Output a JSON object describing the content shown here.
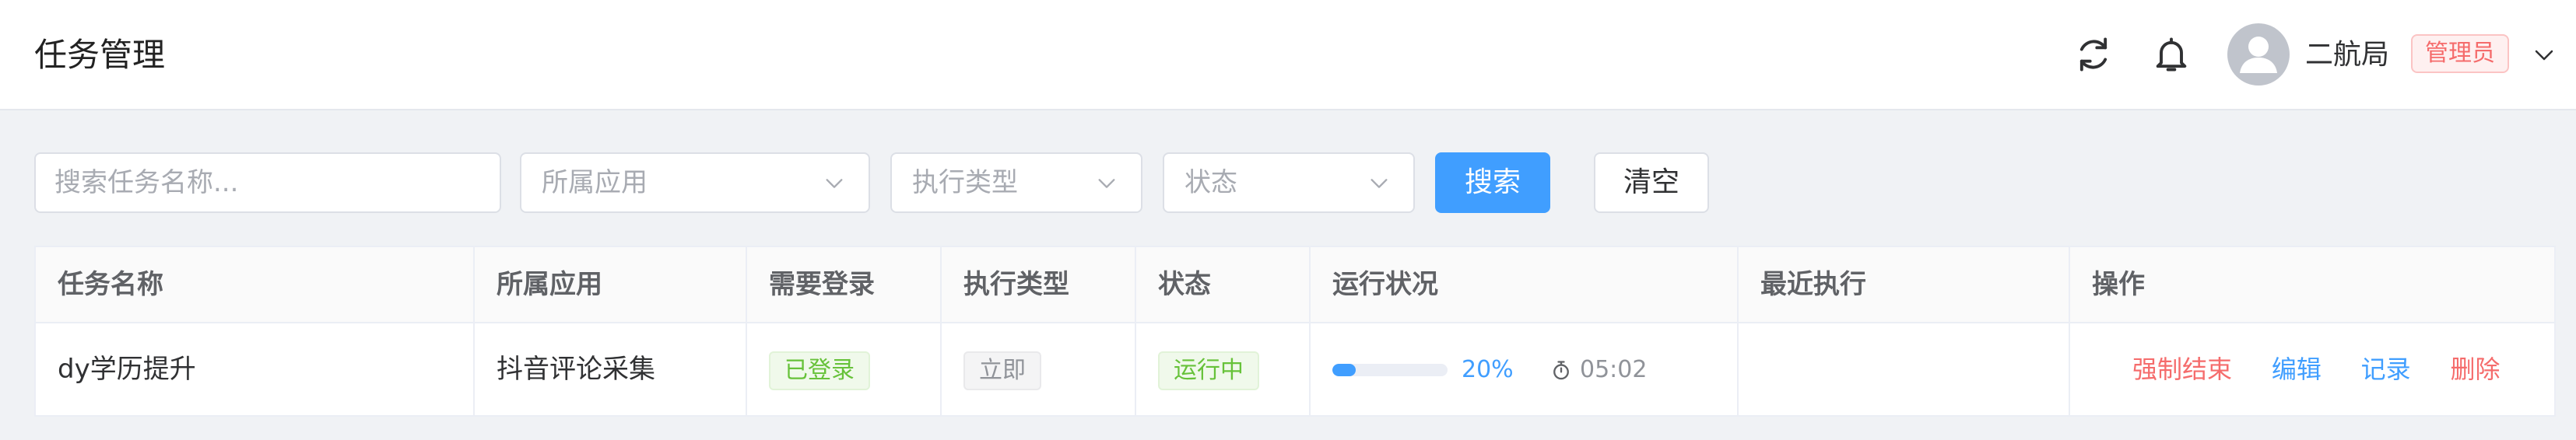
{
  "header": {
    "title": "任务管理",
    "user_name": "二航局",
    "role": "管理员"
  },
  "filters": {
    "search_placeholder": "搜索任务名称...",
    "app_placeholder": "所属应用",
    "exec_type_placeholder": "执行类型",
    "status_placeholder": "状态",
    "search_button": "搜索",
    "clear_button": "清空"
  },
  "table": {
    "columns": [
      "任务名称",
      "所属应用",
      "需要登录",
      "执行类型",
      "状态",
      "运行状况",
      "最近执行",
      "操作"
    ],
    "rows": [
      {
        "task_name": "dy学历提升",
        "app": "抖音评论采集",
        "login": "已登录",
        "exec_type": "立即",
        "status": "运行中",
        "progress": 0.2,
        "progress_text": "20%",
        "elapsed": "05:02",
        "last_run": "",
        "actions": [
          "强制结束",
          "编辑",
          "记录",
          "删除"
        ]
      }
    ]
  },
  "colors": {
    "primary": "#409eff",
    "danger": "#f56c6c",
    "success": "#67c23a"
  },
  "icons": {
    "refresh": "refresh-icon",
    "bell": "bell-icon",
    "avatar": "user-icon",
    "dropdown": "chevron-down-icon",
    "timer": "stopwatch-icon"
  }
}
